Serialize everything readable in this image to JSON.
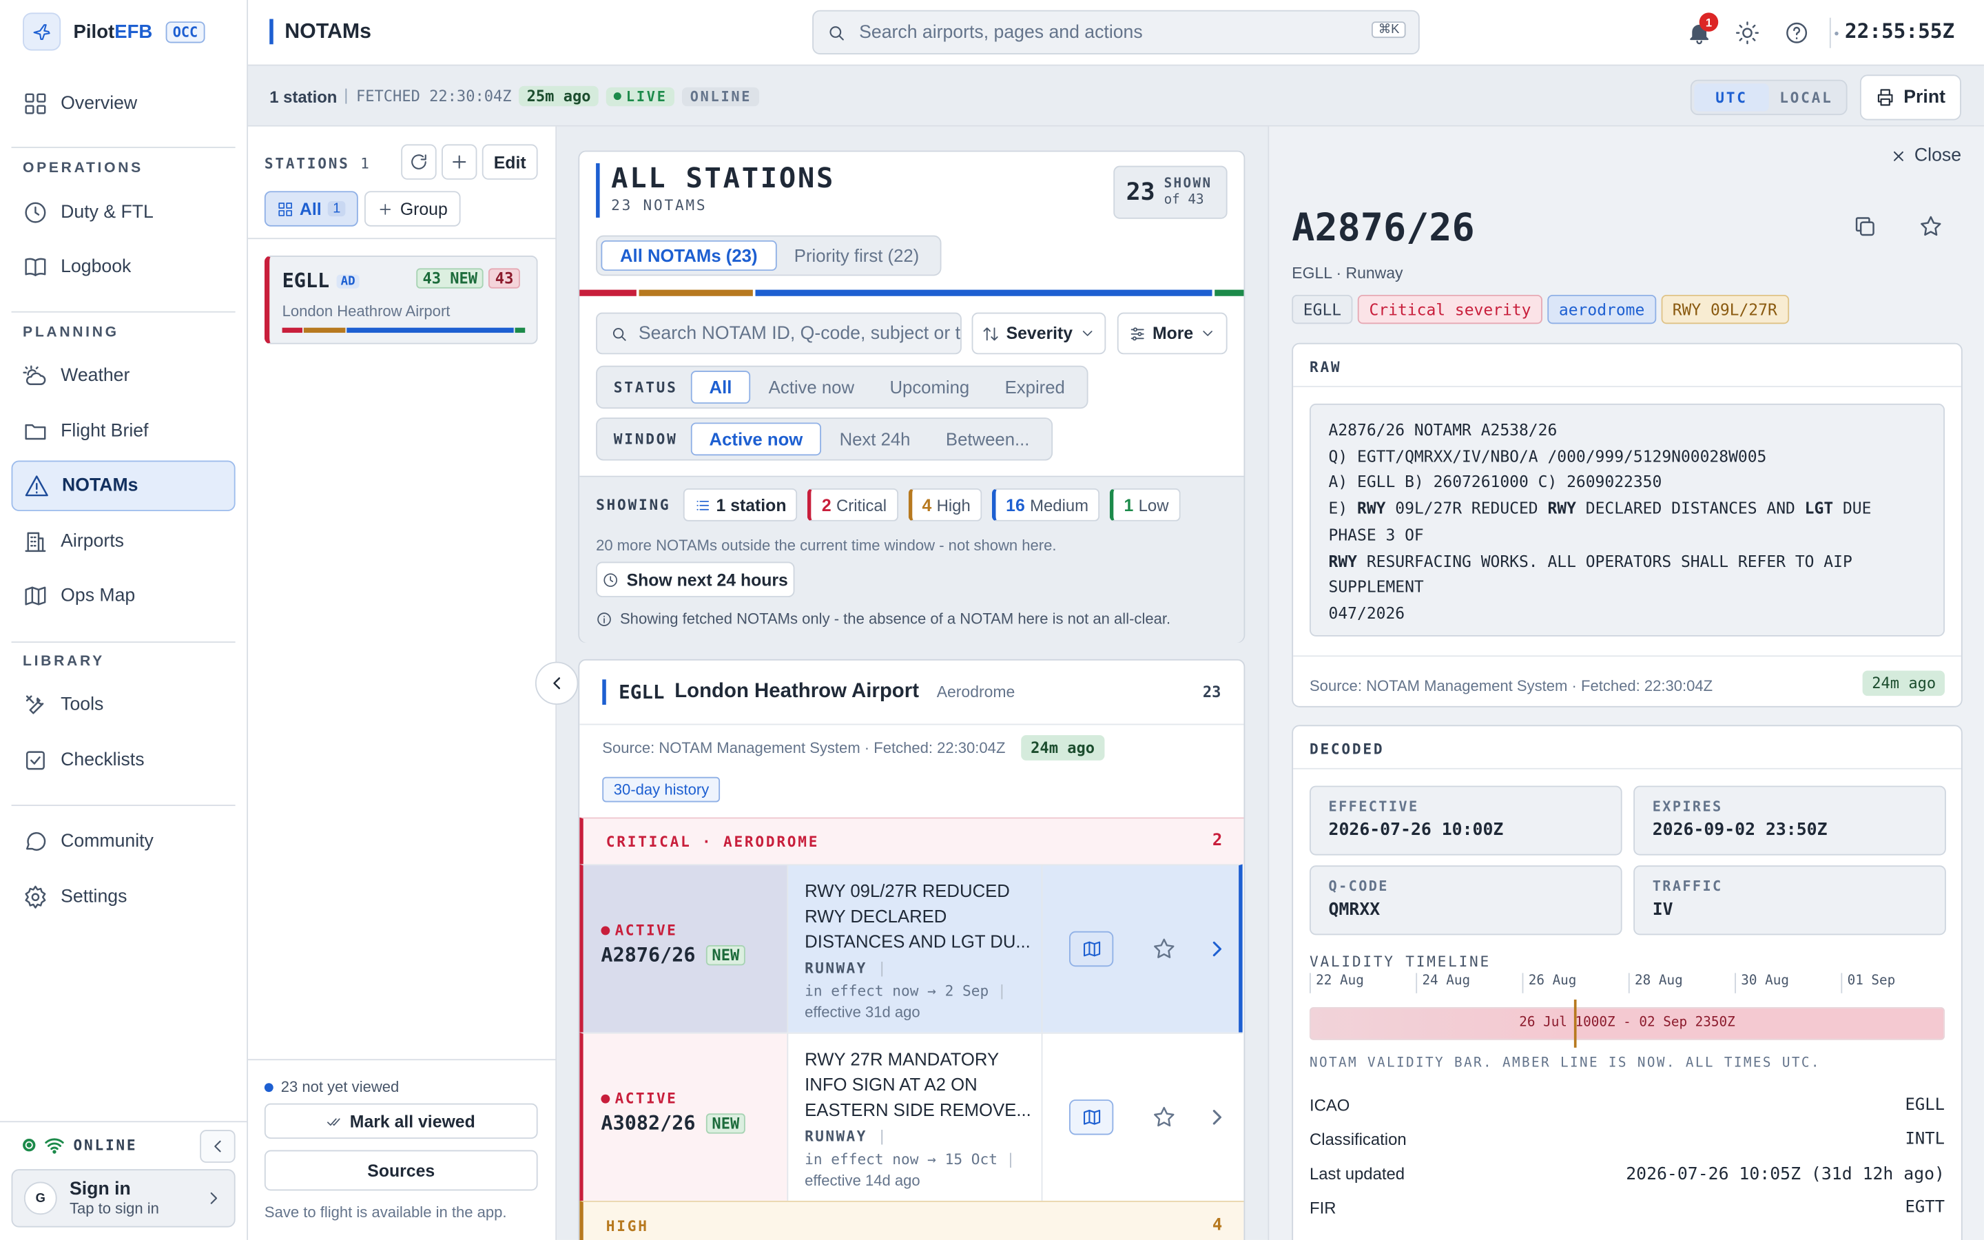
{
  "brand": {
    "name_a": "Pilot",
    "name_b": "EFB",
    "badge": "OCC"
  },
  "sidebar": {
    "overview": "Overview",
    "sections": {
      "operations": "OPERATIONS",
      "planning": "PLANNING",
      "library": "LIBRARY"
    },
    "items": {
      "duty": "Duty & FTL",
      "logbook": "Logbook",
      "weather": "Weather",
      "brief": "Flight Brief",
      "notams": "NOTAMs",
      "airports": "Airports",
      "opsmap": "Ops Map",
      "tools": "Tools",
      "checklists": "Checklists",
      "community": "Community",
      "settings": "Settings"
    },
    "online": "ONLINE",
    "signin": {
      "avatar": "G",
      "title": "Sign in",
      "sub": "Tap to sign in"
    }
  },
  "topbar": {
    "title": "NOTAMs",
    "search_placeholder": "Search airports, pages and actions",
    "shortcut": "⌘K",
    "notif_count": "1",
    "clock": "22:55:55Z"
  },
  "statusbar": {
    "stations": "1 station",
    "fetched": "FETCHED 22:30:04Z",
    "age": "25m ago",
    "live": "LIVE",
    "online": "ONLINE",
    "tz_utc": "UTC",
    "tz_local": "LOCAL",
    "print": "Print"
  },
  "stations_panel": {
    "label": "STATIONS",
    "count": "1",
    "edit": "Edit",
    "all": "All",
    "all_count": "1",
    "group": "Group",
    "card": {
      "icao": "EGLL",
      "type": "AD",
      "new": "43 NEW",
      "total": "43",
      "name": "London Heathrow Airport"
    },
    "not_viewed": "23 not yet viewed",
    "mark_viewed": "Mark all viewed",
    "sources": "Sources",
    "save_note": "Save to flight is available in the app."
  },
  "list_header": {
    "title": "ALL STATIONS",
    "subtitle": "23 NOTAMS",
    "shown": "23",
    "shown_label": "SHOWN",
    "of": "of 43",
    "tabs": {
      "all": "All NOTAMs (23)",
      "priority": "Priority first (22)"
    },
    "search_placeholder": "Search NOTAM ID, Q-code, subject or t",
    "severity": "Severity",
    "more": "More",
    "status": {
      "label": "STATUS",
      "all": "All",
      "active": "Active now",
      "upcoming": "Upcoming",
      "expired": "Expired"
    },
    "window": {
      "label": "WINDOW",
      "active": "Active now",
      "next": "Next 24h",
      "between": "Between..."
    },
    "severity_bar": [
      {
        "name": "critical",
        "color": "#c81e3b",
        "share": 2
      },
      {
        "name": "high",
        "color": "#b7791f",
        "share": 4
      },
      {
        "name": "medium",
        "color": "#1d5fd1",
        "share": 16
      },
      {
        "name": "low",
        "color": "#1c8a4a",
        "share": 1
      }
    ]
  },
  "showing": {
    "label": "SHOWING",
    "station": "1 station",
    "critical_n": "2",
    "critical": "Critical",
    "high_n": "4",
    "high": "High",
    "medium_n": "16",
    "medium": "Medium",
    "low_n": "1",
    "low": "Low",
    "note": "20 more NOTAMs outside the current time window - not shown here.",
    "next_btn": "Show next 24 hours",
    "disclaimer": "Showing fetched NOTAMs only - the absence of a NOTAM here is not an all-clear."
  },
  "airport": {
    "icao": "EGLL",
    "name": "London Heathrow Airport",
    "type": "Aerodrome",
    "count": "23",
    "source": "Source: NOTAM Management System · Fetched: 22:30:04Z",
    "age": "24m ago",
    "history": "30-day history",
    "critical_header": "CRITICAL · AERODROME",
    "critical_count": "2",
    "high_header": "HIGH",
    "high_count": "4"
  },
  "notams": [
    {
      "status": "ACTIVE",
      "id": "A2876/26",
      "new": "NEW",
      "subj1": "RWY 09L/27R REDUCED",
      "subj2": "RWY DECLARED",
      "subj3": "DISTANCES AND LGT DU...",
      "cat": "RUNWAY",
      "time": "in effect now → 2 Sep",
      "eff": "effective 31d ago"
    },
    {
      "status": "ACTIVE",
      "id": "A3082/26",
      "new": "NEW",
      "subj1": "RWY 27R MANDATORY",
      "subj2": "INFO SIGN AT A2 ON",
      "subj3": "EASTERN SIDE REMOVE...",
      "cat": "RUNWAY",
      "time": "in effect now → 15 Oct",
      "eff": "effective 14d ago"
    }
  ],
  "detail": {
    "close": "Close",
    "id": "A2876/26",
    "sub": "EGLL · Runway",
    "tags": {
      "icao": "EGLL",
      "severity": "Critical severity",
      "scope": "aerodrome",
      "rwy": "RWY 09L/27R"
    },
    "raw_label": "RAW",
    "raw": {
      "l1": "A2876/26 NOTAMR A2538/26",
      "l2": "Q) EGTT/QMRXX/IV/NBO/A /000/999/5129N00028W005",
      "l3": "A) EGLL B) 2607261000 C) 2609022350",
      "l4a": "E) ",
      "l4b": "RWY",
      "l4c": " 09L/27R REDUCED ",
      "l4d": "RWY",
      "l4e": " DECLARED DISTANCES AND ",
      "l4f": "LGT",
      "l4g": " DUE",
      "l5": "PHASE 3 OF",
      "l6a": "RWY",
      "l6b": " RESURFACING WORKS. ALL OPERATORS SHALL REFER TO AIP",
      "l7": "SUPPLEMENT",
      "l8": "047/2026"
    },
    "source": "Source: NOTAM Management System · Fetched: 22:30:04Z",
    "age": "24m ago",
    "decoded_label": "DECODED",
    "effective_k": "EFFECTIVE",
    "effective_v": "2026-07-26 10:00Z",
    "expires_k": "EXPIRES",
    "expires_v": "2026-09-02 23:50Z",
    "qcode_k": "Q-CODE",
    "qcode_v": "QMRXX",
    "traffic_k": "TRAFFIC",
    "traffic_v": "IV",
    "timeline_label": "VALIDITY TIMELINE",
    "ticks": [
      "22 Aug",
      "24 Aug",
      "26 Aug",
      "28 Aug",
      "30 Aug",
      "01 Sep"
    ],
    "bar_label": "26 Jul 1000Z - 02 Sep 2350Z",
    "timeline_note": "NOTAM VALIDITY BAR. AMBER LINE IS NOW. ALL TIMES UTC.",
    "kv": [
      {
        "k": "ICAO",
        "v": "EGLL"
      },
      {
        "k": "Classification",
        "v": "INTL"
      },
      {
        "k": "Last updated",
        "v": "2026-07-26 10:05Z (31d 12h ago)"
      },
      {
        "k": "FIR",
        "v": "EGTT"
      }
    ]
  },
  "colors": {
    "accent": "#1d5fd1",
    "critical": "#c81e3b",
    "high": "#b7791f",
    "low": "#1c8a4a",
    "live": "#1c8a4a"
  }
}
